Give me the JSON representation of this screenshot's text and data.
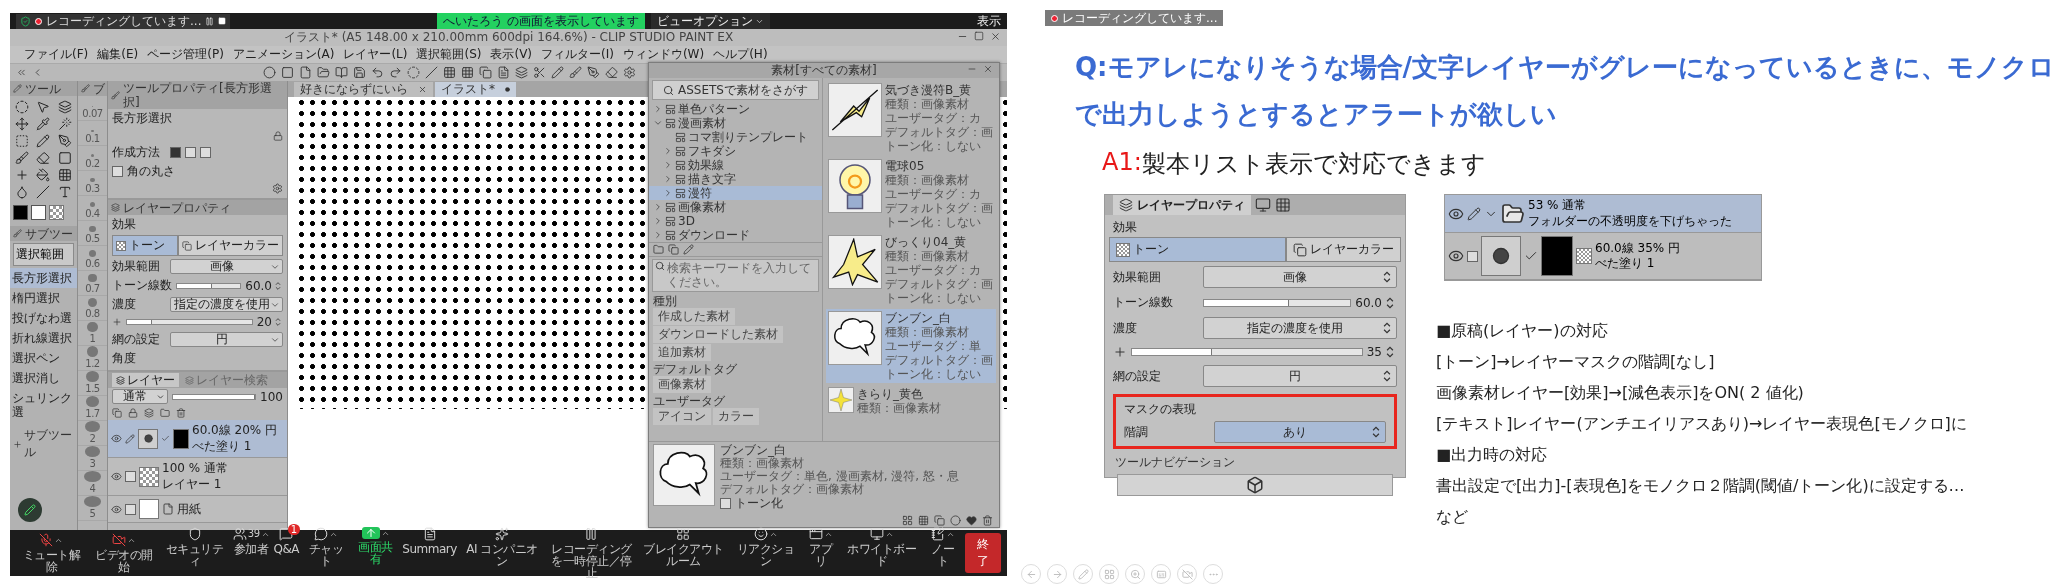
{
  "zoom_top_bar": {
    "recording": "レコーディングしています...",
    "sharing_banner": "へいたろう の画面を表示しています",
    "view_options": "ビューオプション",
    "display": "表示"
  },
  "app": {
    "title": "イラスト* (A5 148.00 x 210.00mm 600dpi 164.6%) - CLIP STUDIO PAINT EX",
    "menu": [
      "ファイル(F)",
      "編集(E)",
      "ページ管理(P)",
      "アニメーション(A)",
      "レイヤー(L)",
      "選択範囲(S)",
      "表示(V)",
      "フィルター(I)",
      "ウィンドウ(W)",
      "ヘルプ(H)"
    ],
    "tool_tab": "ツール",
    "brush_tab": "ブ",
    "brush_sizes": [
      "0.07",
      "0.1",
      "0.2",
      "0.3",
      "0.4",
      "0.5",
      "0.6",
      "0.7",
      "0.8",
      "1",
      "1.2",
      "1.5",
      "1.7",
      "2",
      "3",
      "4",
      "5"
    ],
    "sub_tools": {
      "tab": "サブツー",
      "group": "選択範囲",
      "items": [
        {
          "label": "長方形選択",
          "selected": true
        },
        {
          "label": "楕円選択",
          "selected": false
        },
        {
          "label": "投げなわ選",
          "selected": false
        },
        {
          "label": "折れ線選択",
          "selected": false
        },
        {
          "label": "選択ペン",
          "selected": false
        },
        {
          "label": "選択消し",
          "selected": false
        },
        {
          "label": "シュリンク選",
          "selected": false
        }
      ],
      "add": "サブツール"
    },
    "tool_property": {
      "tab": "ツールプロパティ[長方形選択]",
      "name": "長方形選択",
      "method_label": "作成方法",
      "rounded": {
        "label": "角の丸さ",
        "checked": false
      }
    },
    "layer_property": {
      "tab": "レイヤープロパティ",
      "section": "効果",
      "effects": [
        {
          "label": "トーン",
          "selected": true
        },
        {
          "label": "レイヤーカラー",
          "selected": false
        }
      ],
      "rows": [
        {
          "kind": "select",
          "label": "効果範囲",
          "value": "画像"
        },
        {
          "kind": "slider",
          "label": "トーン線数",
          "value": "60.0",
          "level": 0.55
        },
        {
          "kind": "select",
          "label": "濃度",
          "value": "指定の濃度を使用"
        },
        {
          "kind": "slider",
          "value": "20",
          "level": 0.2
        },
        {
          "kind": "select",
          "label": "網の設定",
          "value": "円"
        },
        {
          "kind": "label",
          "label": "角度"
        }
      ]
    },
    "layer_panel": {
      "tabs": [
        {
          "label": "レイヤー",
          "selected": true
        },
        {
          "label": "レイヤー検索",
          "selected": false
        }
      ],
      "blend_mode": "通常",
      "opacity": {
        "value": "100",
        "level": 1
      },
      "layers": [
        {
          "kind": "tone",
          "line1": "60.0線 20% 円",
          "line2": "べた塗り 1",
          "selected": true
        },
        {
          "kind": "raster",
          "line1": "100 % 通常",
          "line2": "レイヤー 1",
          "selected": false
        },
        {
          "kind": "paper",
          "line1": "用紙",
          "selected": false
        }
      ]
    },
    "canvas_tabs": [
      {
        "label": "好きにならずにいら",
        "selected": false
      },
      {
        "label": "イラスト*",
        "selected": true
      }
    ],
    "material_panel": {
      "title": "素材[すべての素材]",
      "assets_button": "ASSETSで素材をさがす",
      "tree": [
        {
          "label": "単色パターン",
          "leaf": false,
          "expanded": false,
          "selected": false
        },
        {
          "label": "漫画素材",
          "leaf": false,
          "expanded": true,
          "selected": false,
          "children": [
            {
              "label": "コマ割りテンプレート",
              "leaf": true,
              "expanded": false,
              "selected": false
            },
            {
              "label": "フキダシ",
              "leaf": false,
              "expanded": false,
              "selected": false
            },
            {
              "label": "効果線",
              "leaf": false,
              "expanded": false,
              "selected": false
            },
            {
              "label": "描き文字",
              "leaf": false,
              "expanded": false,
              "selected": false
            },
            {
              "label": "漫符",
              "leaf": false,
              "expanded": false,
              "selected": true
            }
          ]
        },
        {
          "label": "画像素材",
          "leaf": false,
          "expanded": false,
          "selected": false
        },
        {
          "label": "3D",
          "leaf": false,
          "expanded": false,
          "selected": false
        },
        {
          "label": "ダウンロード",
          "leaf": false,
          "expanded": false,
          "selected": false
        }
      ],
      "search_placeholder": "検索キーワードを入力してください。",
      "filters": [
        {
          "heading": "種別",
          "tags": [
            "作成した素材",
            "ダウンロードした素材",
            "追加素材"
          ]
        },
        {
          "heading": "デフォルトタグ",
          "tags": [
            "画像素材"
          ]
        },
        {
          "heading": "ユーザータグ",
          "tags": [
            "アイコン",
            "カラー"
          ]
        }
      ],
      "materials": [
        {
          "kind": "lightning",
          "name": "気づき漫符B_黄",
          "lines": [
            "種類：画像素材",
            "ユーザータグ：カ",
            "デフォルトタグ：画",
            "トーン化：しない"
          ],
          "selected": false
        },
        {
          "kind": "bulb",
          "name": "電球05",
          "lines": [
            "種類：画像素材",
            "ユーザータグ：カ",
            "デフォルトタグ：画",
            "トーン化：しない"
          ],
          "selected": false
        },
        {
          "kind": "burst",
          "name": "びっくり04_黄",
          "lines": [
            "種類：画像素材",
            "ユーザータグ：カ",
            "デフォルトタグ：画",
            "トーン化：しない"
          ],
          "selected": false
        },
        {
          "kind": "bubble",
          "name": "ブンブン_白",
          "lines": [
            "種類：画像素材",
            "ユーザータグ：単",
            "デフォルトタグ：画",
            "トーン化：しない"
          ],
          "selected": true
        },
        {
          "kind": "sparkle",
          "name": "きらり_黄色",
          "lines": [
            "種類：画像素材"
          ],
          "selected": false
        }
      ],
      "detail": {
        "kind": "bubble",
        "name": "ブンブン_白",
        "lines": [
          "種類：画像素材",
          "ユーザータグ：単色, 漫画素材, 漫符, 怒・息",
          "デフォルトタグ：画像素材"
        ],
        "tone_checkbox": {
          "label": "トーン化",
          "checked": false
        }
      }
    }
  },
  "meeting_controls": {
    "left": [
      {
        "kind": "mic-off",
        "label": "ミュート解除",
        "menu": true
      },
      {
        "kind": "video-off",
        "label": "ビデオの開始",
        "menu": true
      }
    ],
    "center": [
      {
        "kind": "security",
        "label": "セキュリティ",
        "menu": false
      },
      {
        "kind": "participants",
        "label": "参加者",
        "count": "39",
        "menu": true
      },
      {
        "kind": "qa",
        "label": "Q&A",
        "badge": "1",
        "menu": false
      },
      {
        "kind": "chat",
        "label": "チャット",
        "menu": true
      },
      {
        "kind": "share",
        "label": "画面共有",
        "menu": true
      },
      {
        "kind": "summary",
        "label": "Summary",
        "menu": false
      },
      {
        "kind": "ai",
        "label": "AI コンパニオン",
        "menu": false
      },
      {
        "kind": "record",
        "label": "レコーディングを一時停止／停止",
        "menu": false
      },
      {
        "kind": "breakout",
        "label": "ブレイクアウトルーム",
        "menu": false
      },
      {
        "kind": "reaction",
        "label": "リアクション",
        "menu": true
      },
      {
        "kind": "apps",
        "label": "アプリ",
        "menu": true
      },
      {
        "kind": "whiteboard",
        "label": "ホワイトボード",
        "menu": true
      },
      {
        "kind": "notes",
        "label": "ノート",
        "menu": true
      }
    ],
    "end_button": "終了"
  },
  "slide": {
    "recording_chip": "レコーディングしています...",
    "question_lines": [
      "Q:モアレになりそうな場合/文字レイヤーがグレーになっているときに、モノクロ",
      "で出力しようとするとアラートが欲しい"
    ],
    "answer": {
      "label": "A1:",
      "text": "製本リスト表示で対応できます"
    },
    "property_screenshot": {
      "tab": "レイヤープロパティ",
      "section": "効果",
      "effects": [
        {
          "label": "トーン",
          "selected": true
        },
        {
          "label": "レイヤーカラー",
          "selected": false
        }
      ],
      "rows": [
        {
          "kind": "select",
          "label": "効果範囲",
          "value": "画像"
        },
        {
          "kind": "slider",
          "label": "トーン線数",
          "value": "60.0",
          "level": 0.58
        },
        {
          "kind": "select",
          "label": "濃度",
          "value": "指定の濃度を使用"
        },
        {
          "kind": "slider",
          "value": "35",
          "level": 0.35
        },
        {
          "kind": "select",
          "label": "網の設定",
          "value": "円"
        }
      ],
      "highlight": {
        "section": "マスクの表現",
        "label": "階調",
        "value": "あり"
      },
      "footer_section": "ツールナビゲーション"
    },
    "layer_screenshot": {
      "layers": [
        {
          "kind": "folder",
          "line1": "53 % 通常",
          "line2": "フォルダーの不透明度を下げちゃった",
          "selected": true
        },
        {
          "kind": "tone",
          "line1": "60.0線 35% 円",
          "line2": "べた塗り 1",
          "selected": false
        }
      ]
    },
    "notes": [
      "■原稿(レイヤー)の対応",
      "[トーン]→レイヤーマスクの階調[なし]",
      "画像素材レイヤー[効果]→[減色表示]をON( 2 値化)",
      "[テキスト]レイヤー(アンチエイリアスあり)→レイヤー表現色[モノクロ]に",
      "■出力時の対応",
      "書出設定で[出力]-[表現色]をモノクロ２階調(閾値/トーン化)に設定する…",
      "など"
    ]
  }
}
